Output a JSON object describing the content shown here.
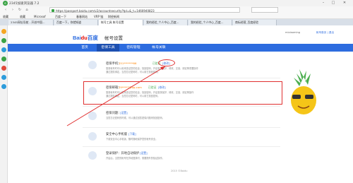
{
  "browser": {
    "title": "2345加速浏览器 7.2",
    "url": "https://passport.baidu.com/v2/accountsecurity?tpl=&_t=1466940823",
    "search_hint": "搜索"
  },
  "bookmarks": [
    "收藏",
    "收藏",
    "Microsof",
    "百度一下",
    "春春网站",
    "VRP 链",
    "财经新闻"
  ],
  "tabs": [
    {
      "label": "2345网址导航 - 开创中国..."
    },
    {
      "label": "百度一下，你就知道"
    },
    {
      "label": "帐号工具 帐号设置",
      "active": true
    },
    {
      "label": "我的经验_个人中心_百度..."
    },
    {
      "label": "我的经验_个人中心_百度..."
    },
    {
      "label": "商标经营_百度经验"
    }
  ],
  "header": {
    "logo_main": "Bai",
    "logo_accent": "du",
    "logo_suffix": "百度",
    "title": "帐号设置",
    "user": "mixiaoming",
    "links": "帐号首页 | 退出"
  },
  "nav": [
    "首页",
    "密保工具",
    "密码管理",
    "帐号关联"
  ],
  "items": [
    {
      "title": "密保手机：",
      "value": "151*******66",
      "status": "已验证",
      "action": "[修改]",
      "desc1": "登录帐号时可以用来查证您的信息，找回密码，开启登录保护、修改、交易、绑定等重要操作",
      "desc2": "通过提前绑定，当您忘记密码时，可以用它找回密码。"
    },
    {
      "title": "密保邮箱：",
      "value": "29****7@qq.com",
      "status": "已验证",
      "action": "[修改]",
      "desc1": "登录帐号时可以用来查证您的信息，找回密码，开启登录保护、修改、交易、绑定等操作",
      "desc2": "通过提前绑定，当您忘记密码时，可以用它找回密码。"
    },
    {
      "title": "密保问题：",
      "value": "",
      "status": "",
      "action": "[设置]",
      "desc1": "当您忘记密码的时候，可以通过回答密保问题来找回密码。",
      "desc2": ""
    },
    {
      "title": "安全中心手机版",
      "value": "",
      "status": "",
      "action": "[下载]",
      "desc1": "下载安全中心手机版，随时随地保护您的帐号安全。",
      "desc2": ""
    },
    {
      "title": "登录保护：异地自动保护",
      "value": "",
      "status": "",
      "action": "[设置]",
      "desc1": "开启后，当您的帐号在异地登录时，需要额外的验证操作。",
      "desc2": ""
    }
  ],
  "footer": "2015 ©Baidu"
}
